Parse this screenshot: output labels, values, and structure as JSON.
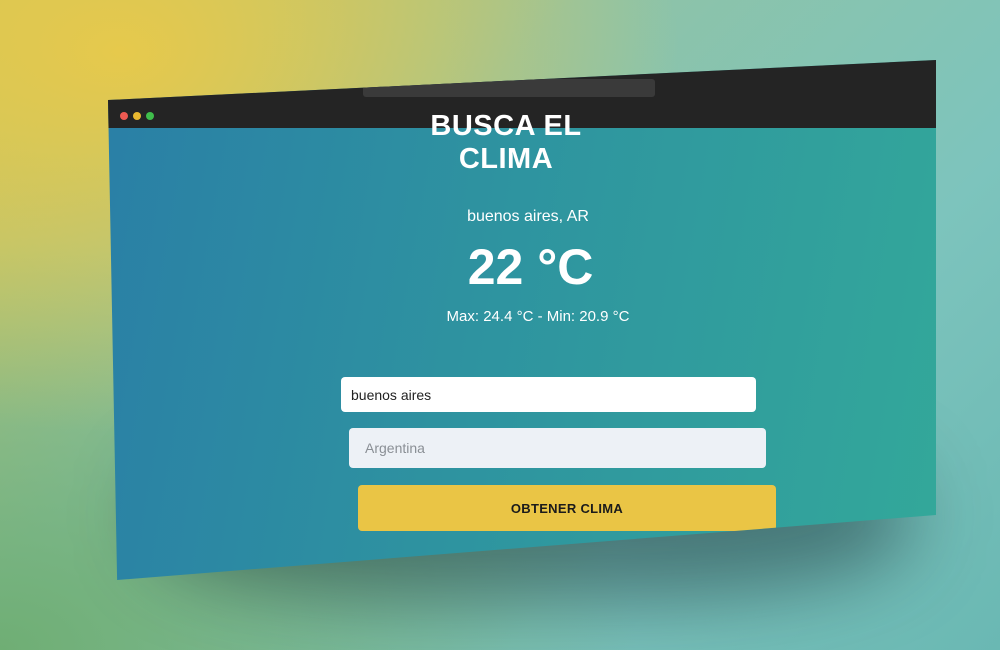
{
  "app": {
    "title": "BUSCA EL CLIMA"
  },
  "weather": {
    "location": "buenos aires, AR",
    "temperature": "22 °C",
    "minmax": "Max: 24.4 °C - Min: 20.9 °C"
  },
  "form": {
    "city_value": "buenos aires",
    "country_placeholder": "Argentina",
    "submit_label": "OBTENER CLIMA"
  },
  "colors": {
    "gradient_start": "#2a7fa6",
    "gradient_end": "#33a89a",
    "button": "#eac545",
    "titlebar": "#242424"
  }
}
